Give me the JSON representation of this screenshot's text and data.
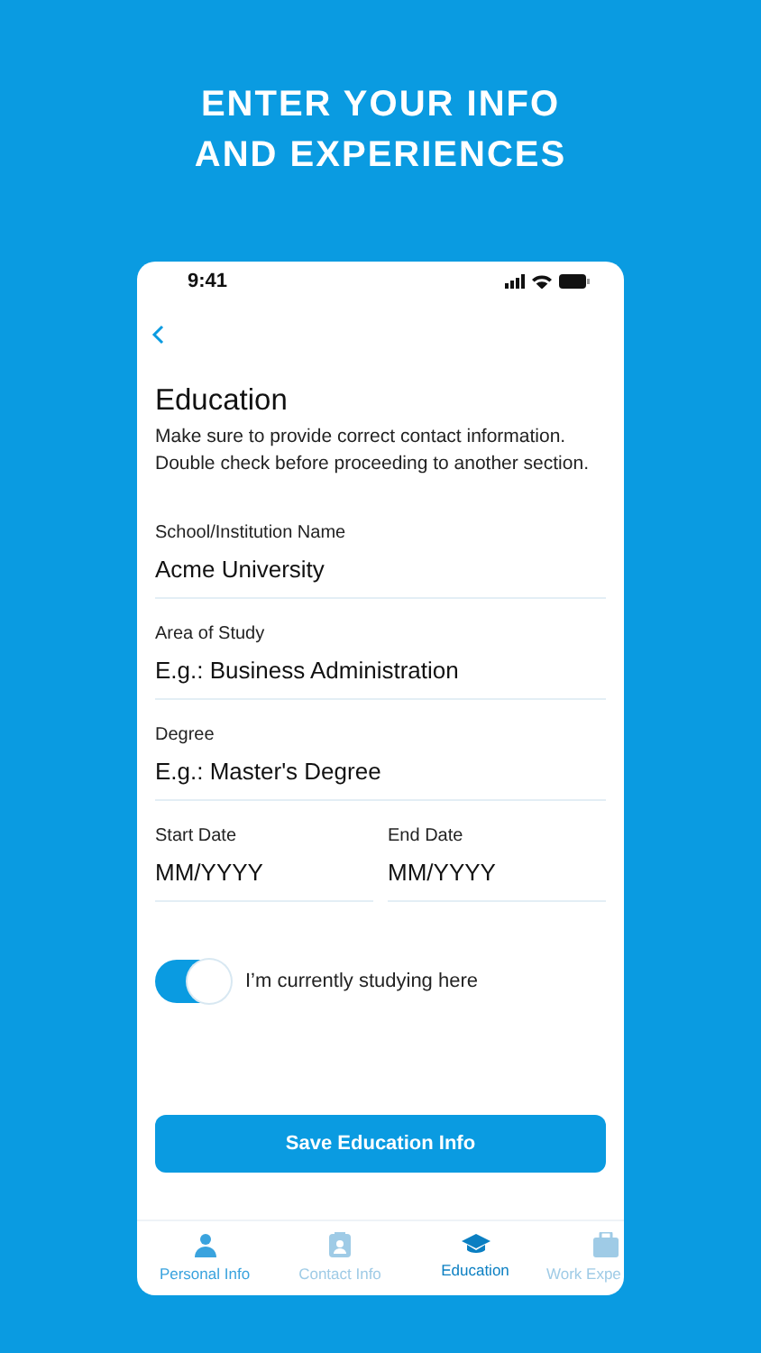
{
  "promo": {
    "headline_lines": [
      "ENTER YOUR INFO",
      "AND EXPERIENCES"
    ]
  },
  "status_bar": {
    "time": "9:41"
  },
  "screen": {
    "title": "Education",
    "description": "Make sure to provide correct contact information. Double check before proceeding to another section."
  },
  "fields": [
    {
      "label": "School/Institution Name",
      "value": "Acme University"
    },
    {
      "label": "Area of Study",
      "placeholder": "E.g.: Business Administration"
    },
    {
      "label": "Degree",
      "placeholder": "E.g.: Master's Degree"
    }
  ],
  "date_fields": [
    {
      "label": "Start Date",
      "placeholder": "MM/YYYY"
    },
    {
      "label": "End Date",
      "placeholder": "MM/YYYY"
    }
  ],
  "toggle": {
    "label": "I’m currently studying here",
    "on": true
  },
  "save_button": "Save Education Info",
  "tabs": [
    {
      "label": "Personal Info",
      "kind": "person",
      "selected": false,
      "completed": true
    },
    {
      "label": "Contact Info",
      "kind": "card",
      "selected": false,
      "completed": false
    },
    {
      "label": "Education",
      "kind": "cap",
      "selected": true,
      "completed": false
    },
    {
      "label": "Work Expe",
      "kind": "briefcase",
      "selected": false,
      "completed": false
    }
  ]
}
